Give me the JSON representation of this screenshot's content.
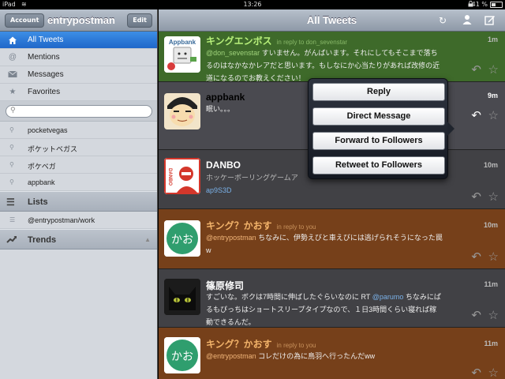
{
  "statusbar": {
    "device": "iPad",
    "time": "13:26",
    "battery": "41 %"
  },
  "sidebar": {
    "account_button": "Account",
    "title": "entrypostman",
    "edit_button": "Edit",
    "nav": [
      {
        "label": "All Tweets",
        "icon": "home-icon"
      },
      {
        "label": "Mentions",
        "icon": "at-icon"
      },
      {
        "label": "Messages",
        "icon": "envelope-icon"
      },
      {
        "label": "Favorites",
        "icon": "star-icon"
      }
    ],
    "search_placeholder": "",
    "saved_searches": [
      "pocketvegas",
      "ポケットベガス",
      "ポケベガ",
      "appbank"
    ],
    "lists_header": "Lists",
    "list_items": [
      "@entrypostman/work"
    ],
    "trends_header": "Trends"
  },
  "main": {
    "title": "All Tweets",
    "tweets": [
      {
        "name": "キングエンボス",
        "reply_to": "in reply to don_sevenstar",
        "time": "1m",
        "mention": "@don_sevenstar",
        "text": " すいません。がんばいます。それにしてもそこまで落ちるのはなかなかレアだと思います。もしなにか心当たりがあれば改修の近道になるのでお教えください！",
        "avatar_text": "Appbank"
      },
      {
        "name": "appbank",
        "reply_to": "",
        "time": "9m",
        "mention": "",
        "text": "眠い。。。",
        "avatar_text": ""
      },
      {
        "name": "DANBO",
        "reply_to": "",
        "time": "10m",
        "mention": "",
        "text": "ホッケーボーリングゲームア",
        "link": "ap9S3D",
        "avatar_text": "DANBO"
      },
      {
        "name": "キング？かおす",
        "reply_to": "in reply to you",
        "time": "10m",
        "mention": "@entrypostman",
        "text": " ちなみに、伊勢えびと車えびには逃げられそうになった罠w",
        "avatar_text": "かお"
      },
      {
        "name": "篠原修司",
        "reply_to": "",
        "time": "11m",
        "mention": "",
        "text": "すごいな。ボクは7時間に伸ばしたぐらいなのに RT ",
        "mention2": "@parumo",
        "text2": " ちなみにぱるもぴっちはショートスリープタイプなので、１日3時間くらい寝れば稼動できるんだ。",
        "avatar_text": ""
      },
      {
        "name": "キング？かおす",
        "reply_to": "in reply to you",
        "time": "11m",
        "mention": "@entrypostman",
        "text": " コレだけの為に鳥羽へ行ったんだww",
        "avatar_text": "かお"
      }
    ],
    "popover": [
      "Reply",
      "Direct Message",
      "Forward to Followers",
      "Retweet to Followers"
    ]
  }
}
